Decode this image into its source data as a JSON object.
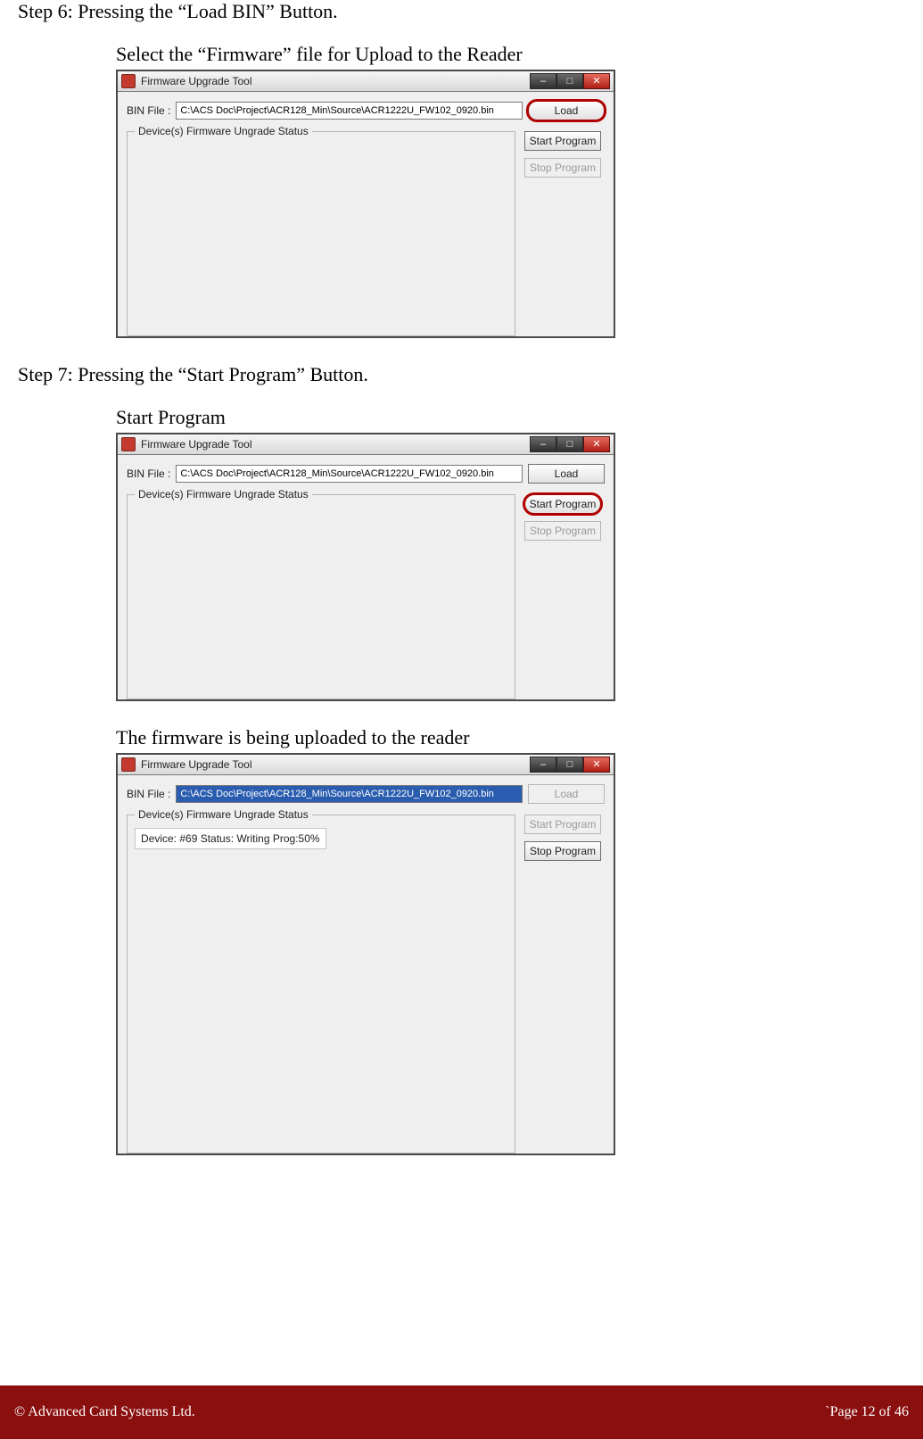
{
  "step6": {
    "heading": "Step 6: Pressing the “Load BIN” Button.",
    "caption": "Select the “Firmware” file for Upload to the Reader"
  },
  "step7": {
    "heading": "Step 7: Pressing the “Start Program” Button.",
    "caption1": "Start Program",
    "caption2": "The firmware is being uploaded to the reader"
  },
  "app": {
    "title": "Firmware Upgrade Tool",
    "bin_label": "BIN File :",
    "bin_path": "C:\\ACS Doc\\Project\\ACR128_Min\\Source\\ACR1222U_FW102_0920.bin",
    "group_label": "Device(s) Firmware Ungrade Status",
    "load_btn": "Load",
    "start_btn": "Start Program",
    "stop_btn": "Stop Program",
    "min_glyph": "–",
    "max_glyph": "□",
    "close_glyph": "✕",
    "status_line": "Device: #69 Status: Writing Prog:50%"
  },
  "footer": {
    "left": "© Advanced Card Systems Ltd.",
    "right": "`Page 12 of 46"
  }
}
